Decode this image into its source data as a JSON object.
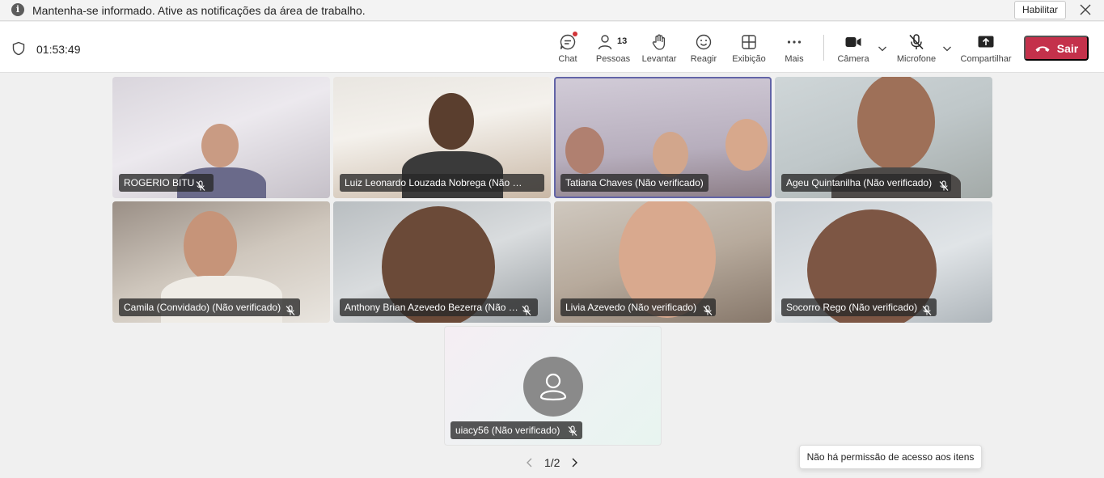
{
  "notification": {
    "message": "Mantenha-se informado. Ative as notificações da área de trabalho.",
    "enable_label": "Habilitar"
  },
  "toolbar": {
    "timer": "01:53:49",
    "chat_label": "Chat",
    "people_label": "Pessoas",
    "people_count": "13",
    "raise_label": "Levantar",
    "react_label": "Reagir",
    "view_label": "Exibição",
    "more_label": "Mais",
    "camera_label": "Câmera",
    "mic_label": "Microfone",
    "share_label": "Compartilhar",
    "leave_label": "Sair"
  },
  "participants": [
    {
      "name": "ROGERIO BITU",
      "muted": true
    },
    {
      "name": "Luiz Leonardo Louzada Nobrega (Não verificado)",
      "muted": true
    },
    {
      "name": "Tatiana Chaves (Não verificado)",
      "muted": false,
      "active": true
    },
    {
      "name": "Ageu Quintanilha (Não verificado)",
      "muted": true
    },
    {
      "name": "Camila (Convidado) (Não verificado)",
      "muted": true
    },
    {
      "name": "Anthony Brian Azevedo Bezerra (Não verificado)",
      "muted": true
    },
    {
      "name": "Livia Azevedo (Não verificado)",
      "muted": true
    },
    {
      "name": "Socorro Rego (Não verificado)",
      "muted": true
    },
    {
      "name": "uiacy56 (Não verificado)",
      "muted": true
    }
  ],
  "pager": {
    "label": "1/2"
  },
  "toast": {
    "message": "Não há permissão de acesso aos itens"
  },
  "colors": {
    "accent": "#6264a7",
    "leave": "#c4314b",
    "badge": "#d13438"
  }
}
